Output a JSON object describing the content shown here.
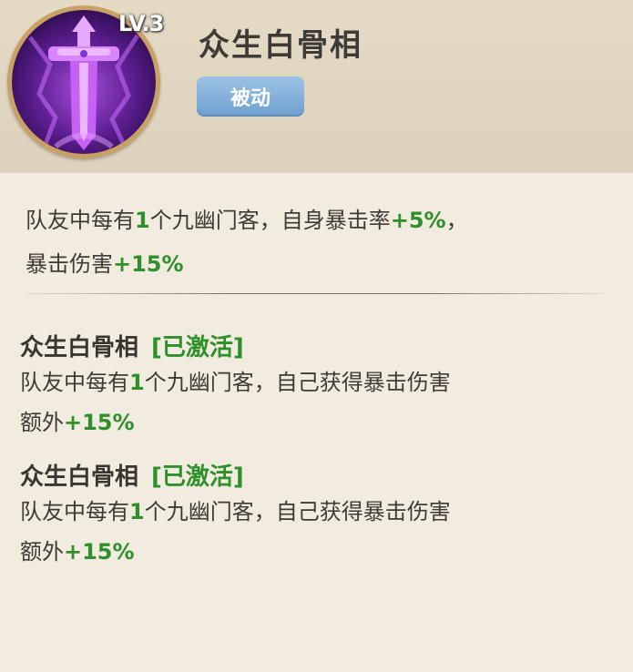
{
  "skill": {
    "level": "LV.3",
    "name": "众生白骨相",
    "type_label": "被动",
    "icon": "sword-icon"
  },
  "description": {
    "line1_prefix": "队友中每有",
    "line1_num": "1",
    "line1_mid": "个九幽门客，自身暴击率",
    "line1_bonus": "+5%",
    "line1_end": "，",
    "line2_prefix": "暴击伤害",
    "line2_bonus": "+15%"
  },
  "effects": [
    {
      "name": "众生白骨相",
      "status": "[已激活]",
      "prefix": "队友中每有",
      "num": "1",
      "mid": "个九幽门客，自己获得暴击伤害",
      "line2_prefix": "额外",
      "bonus": "+15%"
    },
    {
      "name": "众生白骨相",
      "status": "[已激活]",
      "prefix": "队友中每有",
      "num": "1",
      "mid": "个九幽门客，自己获得暴击伤害",
      "line2_prefix": "额外",
      "bonus": "+15%"
    }
  ],
  "colors": {
    "accent_green": "#2f8f2a",
    "badge_blue": "#7aa9d6",
    "icon_purple": "#7a2fc0",
    "frame_gold": "#c9a164"
  }
}
